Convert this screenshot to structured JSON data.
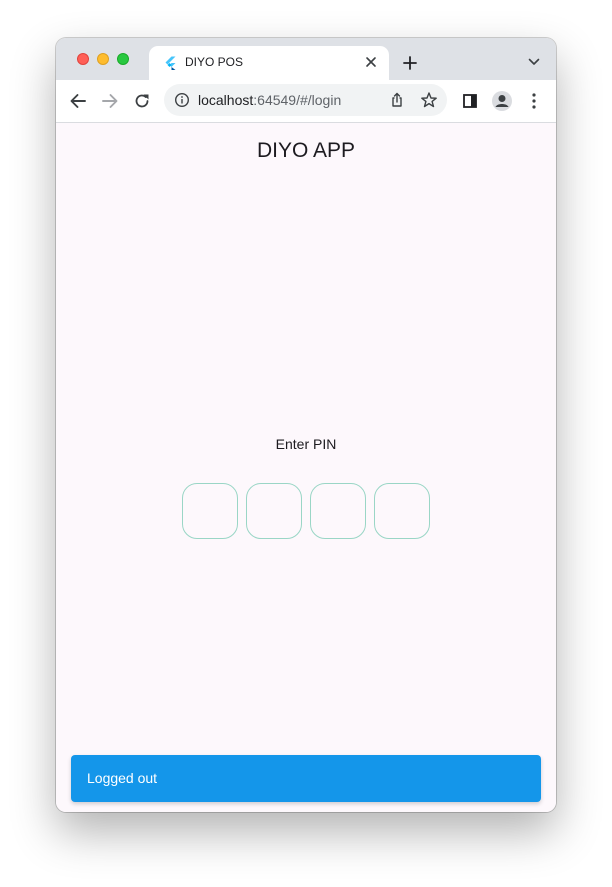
{
  "browser": {
    "tab": {
      "title": "DIYO POS",
      "favicon": "flutter-icon"
    },
    "url": {
      "host": "localhost",
      "rest": ":64549/#/login"
    },
    "icons": {
      "back": "arrow-left-icon",
      "forward": "arrow-right-icon",
      "reload": "reload-icon",
      "info": "info-icon",
      "share": "share-icon",
      "bookmark": "star-icon",
      "sidepanel": "side-panel-icon",
      "profile": "profile-icon",
      "menu": "kebab-menu-icon",
      "new_tab": "plus-icon",
      "tab_list": "chevron-down-icon",
      "close_tab": "close-icon"
    }
  },
  "app": {
    "title": "DIYO APP",
    "pin_label": "Enter PIN",
    "pin_fields": [
      "",
      "",
      "",
      ""
    ],
    "snackbar": "Logged out"
  },
  "colors": {
    "background": "#fdf8fc",
    "pin_border": "#9ad6c6",
    "snackbar": "#1496ea",
    "tabstrip": "#dee1e6"
  }
}
